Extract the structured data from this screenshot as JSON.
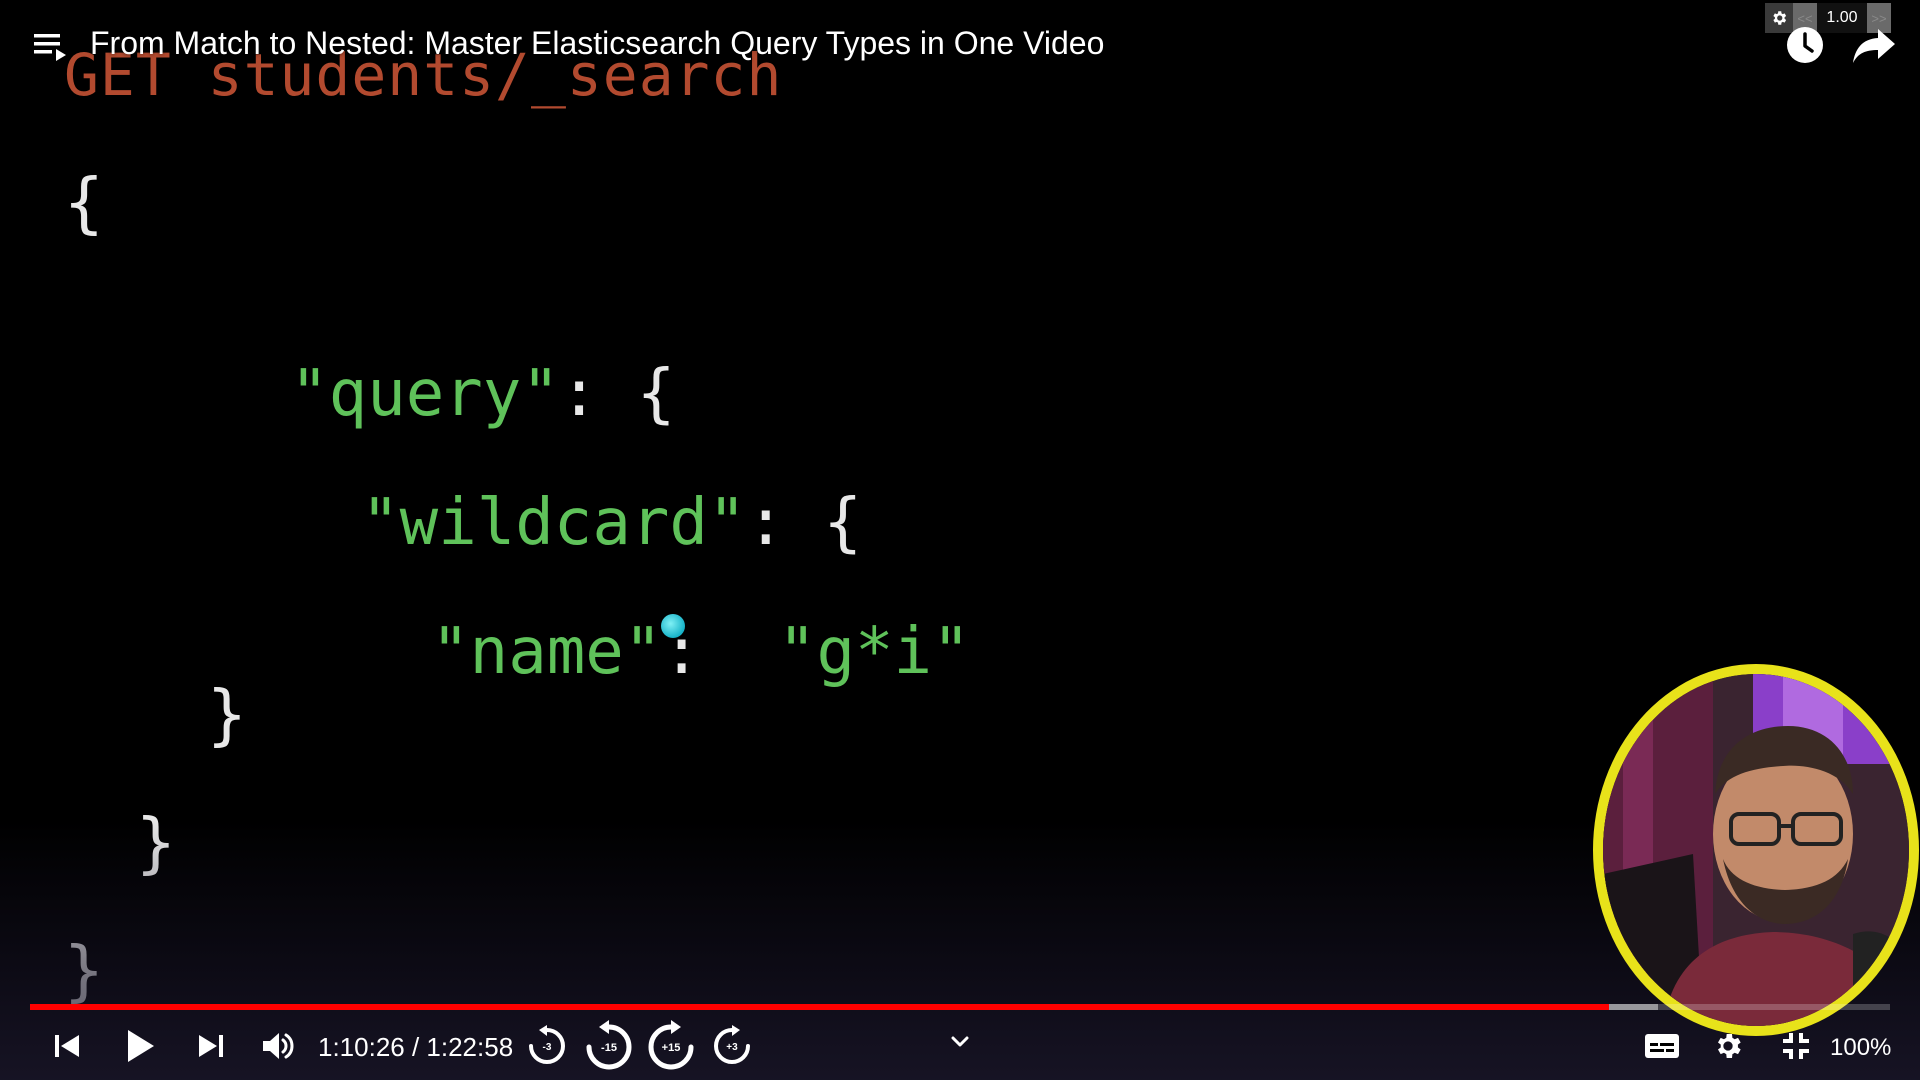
{
  "video": {
    "title": "From Match to Nested: Master Elasticsearch Query Types in One Video"
  },
  "slide": {
    "request_line": "GET students/_search",
    "open_brace": "{",
    "query_key": "\"query\"",
    "wildcard_key": "\"wildcard\"",
    "name_key": "\"name\"",
    "name_value": "\"g*i\"",
    "colon_open": ": {",
    "colon": ": ",
    "close_brace": "}"
  },
  "speed_widget": {
    "value": "1.00",
    "decrease_label": "<<",
    "increase_label": ">>"
  },
  "player": {
    "current_time": "1:10:26",
    "duration": "1:22:58",
    "time_text": "1:10:26 / 1:22:58",
    "played_fraction": 0.849,
    "buffered_fraction": 0.875,
    "rewind_small_label": "-3",
    "rewind_large_label": "-15",
    "forward_large_label": "+15",
    "forward_small_label": "+3",
    "zoom_label": "100%"
  },
  "colors": {
    "progress": "#ff0000",
    "webcam_border": "#e8e21a",
    "code_key": "#5fc25a",
    "code_request": "#b24a2f",
    "cursor": "#17b3c8"
  },
  "icons": [
    "playlist-icon",
    "watch-later-icon",
    "share-icon",
    "gear-icon",
    "previous-icon",
    "play-icon",
    "next-icon",
    "volume-icon",
    "rewind-icon",
    "forward-icon",
    "chevron-down-icon",
    "subtitles-icon",
    "settings-icon",
    "exit-fullscreen-icon"
  ]
}
